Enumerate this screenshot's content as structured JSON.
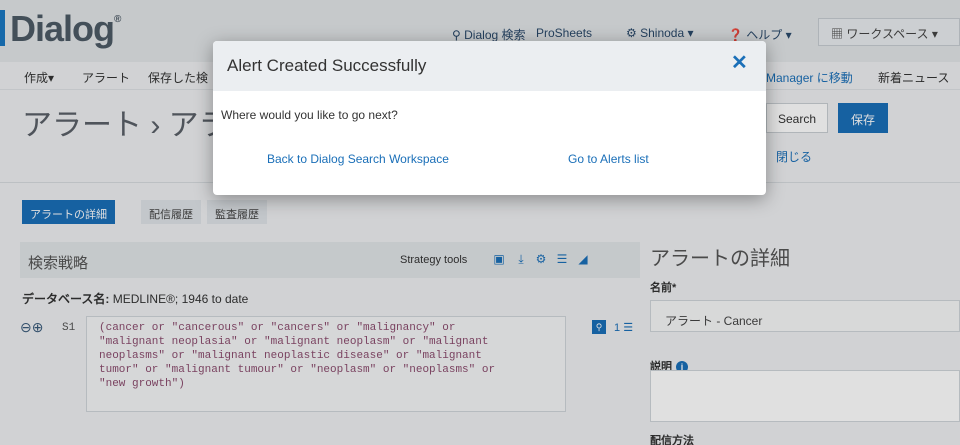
{
  "header": {
    "logo": "Dialog",
    "logo_mark": "®",
    "nav": {
      "search_label": "Dialog 検索",
      "prosheets_label": "ProSheets",
      "user_label": "Shinoda",
      "help_label": "ヘルプ",
      "workspace_label": "ワークスペース"
    }
  },
  "menu": {
    "create_label": "作成",
    "alerts_label": "アラート",
    "saved_label": "保存した検",
    "manager_link": "Manager に移動",
    "news_label": "新着ニュース"
  },
  "page": {
    "heading": "アラート › アラ",
    "search_button": "Search",
    "save_button": "保存",
    "close_link": "閉じる"
  },
  "tabs": [
    {
      "label": "アラートの詳細"
    },
    {
      "label": "配信履歴"
    },
    {
      "label": "監査履歴"
    }
  ],
  "strategy": {
    "title": "検索戦略",
    "tools_label": "Strategy tools",
    "database_label": "データベース名:",
    "database_value": "MEDLINE®; 1946 to date",
    "step_label": "S1",
    "query_lines": [
      "(cancer or \"cancerous\" or \"cancers\" or \"malignancy\" or",
      "\"malignant neoplasia\" or \"malignant neoplasm\" or \"malignant",
      "neoplasms\" or \"malignant neoplastic disease\" or \"malignant",
      "tumor\" or \"malignant tumour\" or \"neoplasm\" or \"neoplasms\" or",
      "\"new growth\")"
    ],
    "result_count": "1"
  },
  "details": {
    "title": "アラートの詳細",
    "name_label": "名前*",
    "name_value": "アラート - Cancer",
    "description_label": "説明",
    "delivery_label": "配信方法"
  },
  "modal": {
    "title": "Alert Created Successfully",
    "question": "Where would you like to go next?",
    "link_workspace": "Back to Dialog Search Workspace",
    "link_alerts": "Go to Alerts list"
  },
  "colors": {
    "accent": "#1a6fb8",
    "query_text": "#8b4c6e"
  }
}
